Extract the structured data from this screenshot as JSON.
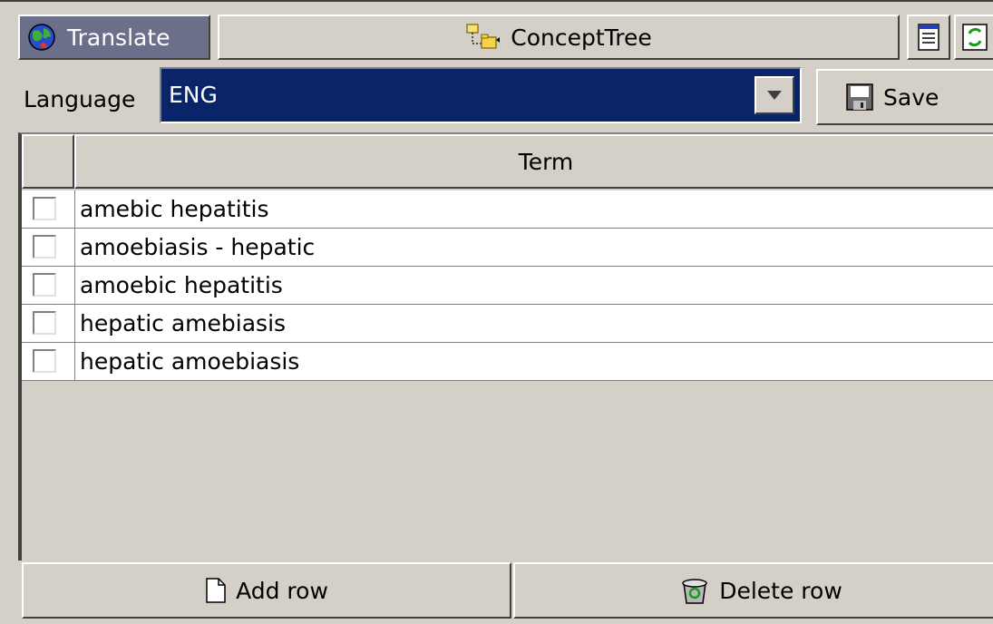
{
  "window": {
    "translate_tab_label": "Translate",
    "concept_tree_label": "ConceptTree"
  },
  "toolbar": {
    "language_label": "Language",
    "language_value": "ENG",
    "save_label": "Save"
  },
  "table": {
    "column_header": "Term",
    "rows": [
      {
        "term": "amebic hepatitis",
        "checked": false
      },
      {
        "term": "amoebiasis - hepatic",
        "checked": false
      },
      {
        "term": "amoebic hepatitis",
        "checked": false
      },
      {
        "term": "hepatic amebiasis",
        "checked": false
      },
      {
        "term": "hepatic amoebiasis",
        "checked": false
      }
    ]
  },
  "actions": {
    "add_row_label": "Add row",
    "delete_row_label": "Delete row"
  },
  "icons": {
    "translate": "globe-icon",
    "concept_tree": "folder-tree-icon",
    "document": "document-icon",
    "refresh": "refresh-icon",
    "save": "floppy-disk-icon",
    "add_row": "new-page-icon",
    "delete_row": "recycle-bin-icon",
    "dropdown": "chevron-down-icon"
  },
  "colors": {
    "selection": "#0a246a",
    "panel": "#d4d0c8",
    "tab_active": "#6b6f8a"
  }
}
